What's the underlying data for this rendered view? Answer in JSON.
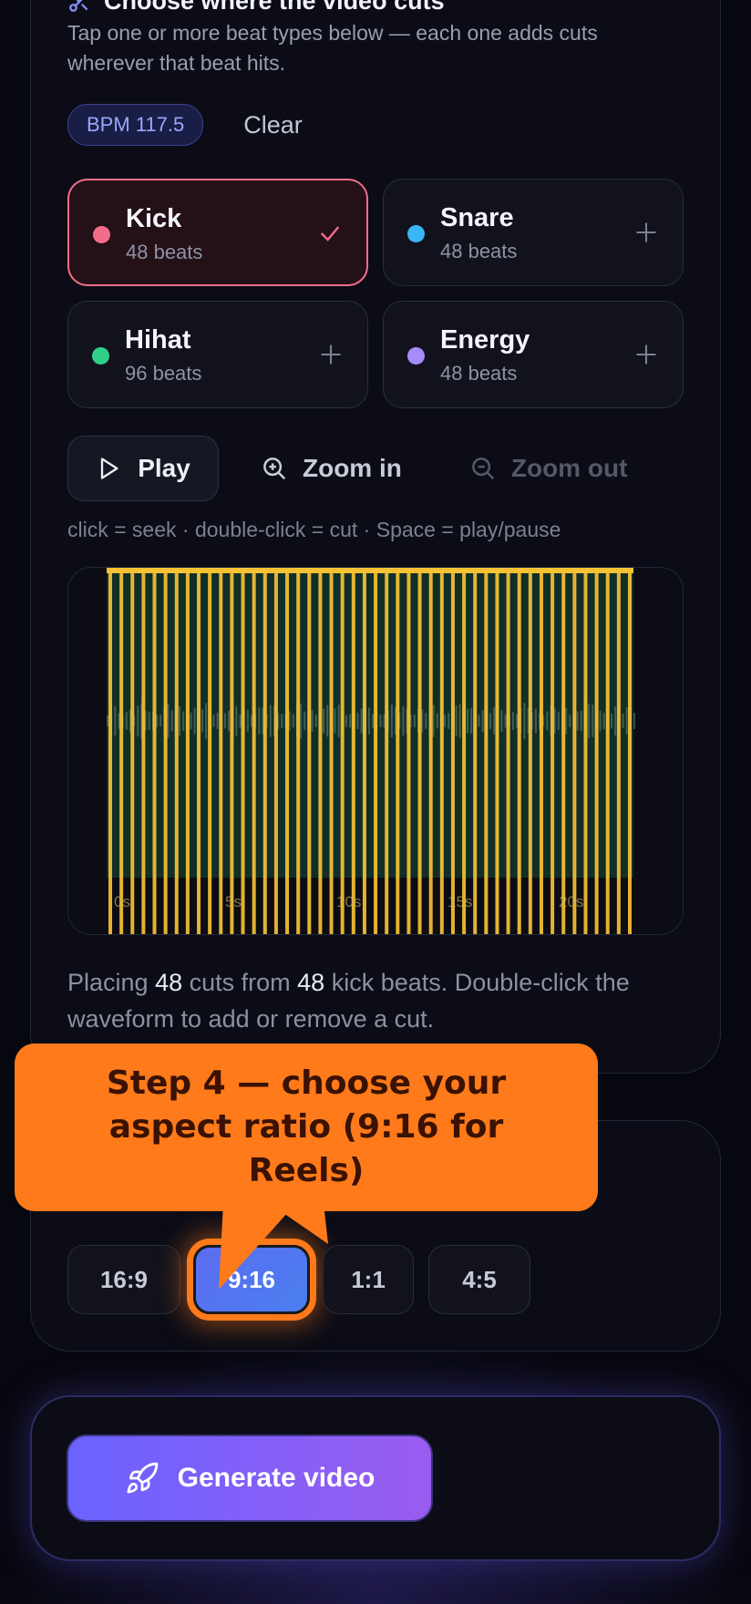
{
  "section_cuts": {
    "title": "Choose where the video cuts",
    "subtitle": "Tap one or more beat types below — each one adds cuts wherever that beat hits.",
    "bpm_label": "BPM 117.5",
    "clear_label": "Clear",
    "beat_types": [
      {
        "name": "Kick",
        "count": "48 beats",
        "color": "#f36d8a",
        "selected": true
      },
      {
        "name": "Snare",
        "count": "48 beats",
        "color": "#38b6f5",
        "selected": false
      },
      {
        "name": "Hihat",
        "count": "96 beats",
        "color": "#2fd08a",
        "selected": false
      },
      {
        "name": "Energy",
        "count": "48 beats",
        "color": "#a78bfa",
        "selected": false
      }
    ],
    "controls": {
      "play": "Play",
      "zoom_in": "Zoom in",
      "zoom_out": "Zoom out"
    },
    "hint": "click = seek · double-click = cut · Space = play/pause",
    "waveform": {
      "cut_color": "#f6c233",
      "cut_count": 48,
      "time_labels": [
        "0s",
        "5s",
        "10s",
        "15s",
        "20s"
      ]
    },
    "status": {
      "prefix": "Placing ",
      "cuts": "48",
      "middle": " cuts from ",
      "beats": "48",
      "suffix": " kick beats. Double-click the waveform to add or remove a cut."
    }
  },
  "section_aspect": {
    "ratios": [
      "16:9",
      "9:16",
      "1:1",
      "4:5"
    ],
    "selected": "9:16"
  },
  "callout": {
    "text": "Step 4 — choose your aspect ratio (9:16 for Reels)",
    "color": "#ff7a1a"
  },
  "generate": {
    "label": "Generate video"
  },
  "colors": {
    "accent": "#6a62ff",
    "background": "#07080f"
  }
}
